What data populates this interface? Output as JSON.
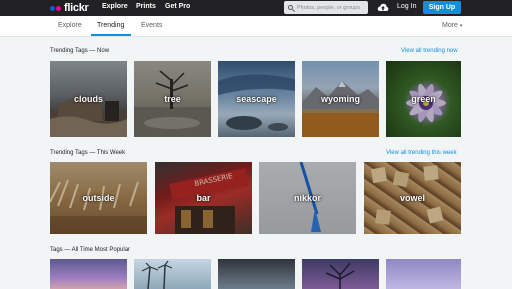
{
  "topbar": {
    "logo_text": "flickr",
    "nav": [
      "Explore",
      "Prints",
      "Get Pro"
    ],
    "search_placeholder": "Photos, people, or groups",
    "login_label": "Log In",
    "signup_label": "Sign Up"
  },
  "subnav": {
    "tabs": [
      "Explore",
      "Trending",
      "Events"
    ],
    "active_tab": "Trending",
    "more_label": "More"
  },
  "sections": [
    {
      "title": "Trending Tags — Now",
      "view_all": "View all trending now",
      "tags": [
        "clouds",
        "tree",
        "seascape",
        "wyoming",
        "green"
      ]
    },
    {
      "title": "Trending Tags — This Week",
      "view_all": "View all trending this week",
      "tags": [
        "outside",
        "bar",
        "nikkor",
        "vowel"
      ]
    },
    {
      "title": "Tags — All Time Most Popular"
    }
  ],
  "colors": {
    "topbar_bg": "#212124",
    "accent_blue": "#128fdc",
    "logo_blue": "#0063dc",
    "logo_pink": "#ff0084",
    "page_bg": "#f2f5f6"
  },
  "icons": {
    "search": "search-icon",
    "upload": "cloud-upload-icon",
    "more": "chevron-down-icon"
  }
}
